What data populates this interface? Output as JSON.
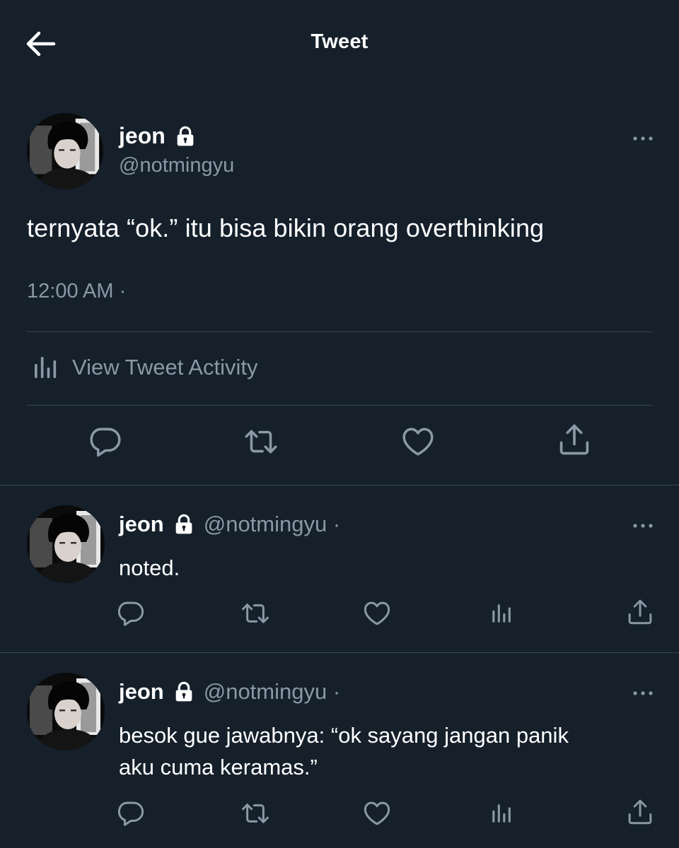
{
  "header": {
    "title": "Tweet",
    "back_icon": "arrow-left-icon"
  },
  "main_tweet": {
    "name": "jeon",
    "handle": "@notmingyu",
    "text": "ternyata “ok.” itu bisa bikin orang overthinking",
    "timestamp": "12:00 AM ·",
    "activity_label": "View Tweet Activity",
    "actions": [
      "reply-icon",
      "retweet-icon",
      "like-icon",
      "share-icon"
    ]
  },
  "replies": [
    {
      "name": "jeon",
      "handle": "@notmingyu ·",
      "text": "noted."
    },
    {
      "name": "jeon",
      "handle": "@notmingyu ·",
      "text_lines": [
        "besok gue jawabnya: “ok sayang jangan panik",
        "aku cuma keramas.”"
      ]
    }
  ],
  "colors": {
    "background": "#15202b",
    "muted": "#8b98a5",
    "divider": "#38444d",
    "text": "#ffffff"
  }
}
